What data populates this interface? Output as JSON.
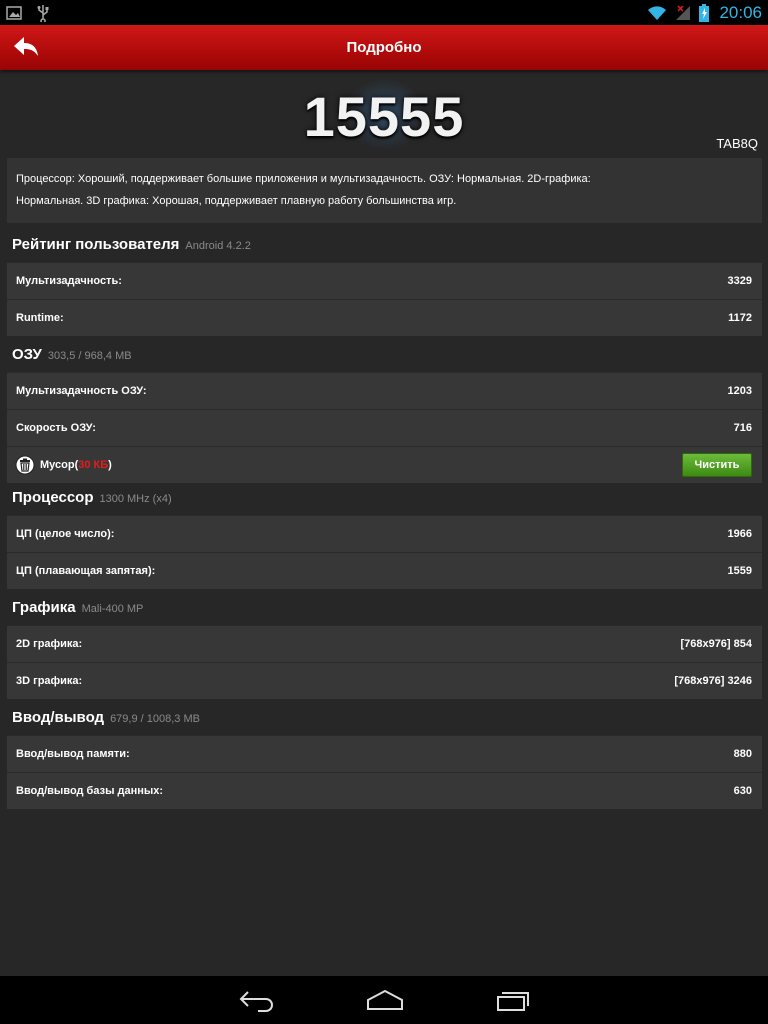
{
  "status_bar": {
    "time": "20:06"
  },
  "action_bar": {
    "title": "Подробно"
  },
  "score": "15555",
  "device": "TAB8Q",
  "summary": "Процессор: Хороший, поддерживает большие приложения и мультизадачность. ОЗУ: Нормальная. 2D-графика: Нормальная. 3D графика: Хорошая, поддерживает плавную работу большинства игр.",
  "sections": {
    "ux": {
      "name": "Рейтинг пользователя",
      "sub": "Android 4.2.2",
      "rows": [
        {
          "label": "Мультизадачность:",
          "value": "3329"
        },
        {
          "label": "Runtime:",
          "value": "1172"
        }
      ]
    },
    "ram": {
      "name": "ОЗУ",
      "sub": "303,5 / 968,4 MB",
      "rows": [
        {
          "label": "Мультизадачность ОЗУ:",
          "value": "1203"
        },
        {
          "label": "Скорость ОЗУ:",
          "value": "716"
        }
      ],
      "trash": {
        "label": "Мусор(",
        "size": "30 КБ",
        "close": ")",
        "button": "Чистить"
      }
    },
    "cpu": {
      "name": "Процессор",
      "sub": "1300 MHz (x4)",
      "rows": [
        {
          "label": "ЦП (целое число):",
          "value": "1966"
        },
        {
          "label": "ЦП (плавающая запятая):",
          "value": "1559"
        }
      ]
    },
    "gpu": {
      "name": "Графика",
      "sub": "Mali-400 MP",
      "rows": [
        {
          "label": "2D графика:",
          "value": "[768x976] 854"
        },
        {
          "label": "3D графика:",
          "value": "[768x976] 3246"
        }
      ]
    },
    "io": {
      "name": "Ввод/вывод",
      "sub": "679,9 / 1008,3 MB",
      "rows": [
        {
          "label": "Ввод/вывод памяти:",
          "value": "880"
        },
        {
          "label": "Ввод/вывод базы данных:",
          "value": "630"
        }
      ]
    }
  },
  "colors": {
    "accent": "#33b5e5",
    "actionbar": "#b00a0a",
    "trash_size": "#e51c1c",
    "button": "#4f9e22"
  }
}
